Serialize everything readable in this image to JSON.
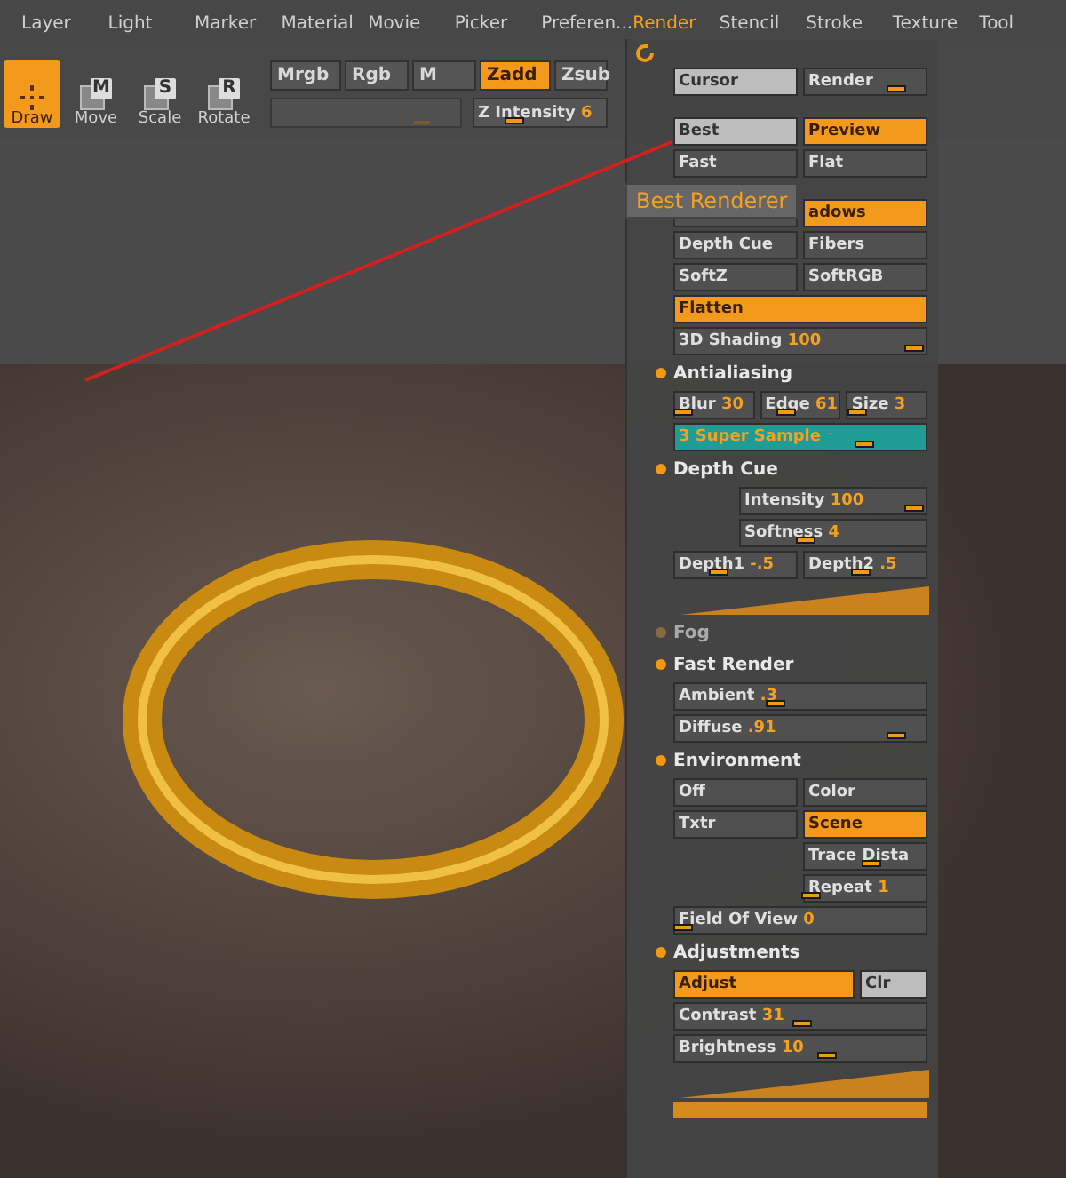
{
  "menu": [
    {
      "label": "Layer",
      "selected": false
    },
    {
      "label": "Light",
      "selected": false
    },
    {
      "label": "Marker",
      "selected": false
    },
    {
      "label": "Material",
      "selected": false
    },
    {
      "label": "Movie",
      "selected": false
    },
    {
      "label": "Picker",
      "selected": false
    },
    {
      "label": "Preferen...",
      "selected": false
    },
    {
      "label": "Render",
      "selected": true
    },
    {
      "label": "Stencil",
      "selected": false
    },
    {
      "label": "Stroke",
      "selected": false
    },
    {
      "label": "Texture",
      "selected": false
    },
    {
      "label": "Tool",
      "selected": false
    }
  ],
  "tools": [
    {
      "label": "Draw",
      "selected": true
    },
    {
      "label": "Move",
      "key": "M",
      "selected": false
    },
    {
      "label": "Scale",
      "key": "S",
      "selected": false
    },
    {
      "label": "Rotate",
      "key": "R",
      "selected": false
    }
  ],
  "modes": [
    {
      "label": "Mrgb",
      "on": false
    },
    {
      "label": "Rgb",
      "on": false
    },
    {
      "label": "M",
      "on": false
    },
    {
      "label": "Zadd",
      "on": true
    },
    {
      "label": "Zsub",
      "on": false
    }
  ],
  "rgb_intensity": {
    "level": 0.8
  },
  "z_intensity": {
    "label": "Z Intensity",
    "value": "6",
    "level": 0.3
  },
  "tooltip": "Best Renderer",
  "panel": [
    {
      "kind": "row",
      "buttons": [
        {
          "kind": "switch",
          "label": "Cursor",
          "on": true
        },
        {
          "kind": "slider",
          "label": "Render",
          "level": 0.75
        }
      ]
    },
    {
      "kind": "row",
      "buttons": [
        {
          "kind": "switch",
          "label": "Best",
          "on": true
        },
        {
          "kind": "toggle",
          "label": "Preview",
          "on": true
        }
      ]
    },
    {
      "kind": "row",
      "buttons": [
        {
          "kind": "toggle",
          "label": "Fast",
          "on": false
        },
        {
          "kind": "toggle",
          "label": "Flat",
          "on": false
        }
      ]
    },
    {
      "kind": "row",
      "buttons": [
        {
          "kind": "toggle",
          "on": false
        },
        {
          "kind": "toggle",
          "label": "adows",
          "on": true
        }
      ]
    },
    {
      "kind": "row",
      "buttons": [
        {
          "kind": "toggle",
          "label": "Depth Cue",
          "on": false
        },
        {
          "kind": "toggle",
          "label": "Fibers",
          "on": false
        }
      ]
    },
    {
      "kind": "row",
      "buttons": [
        {
          "kind": "toggle",
          "label": "SoftZ",
          "on": false
        },
        {
          "kind": "toggle",
          "label": "SoftRGB",
          "on": false
        }
      ]
    },
    {
      "kind": "row",
      "buttons": [
        {
          "kind": "toggle",
          "label": "Flatten",
          "on": true
        }
      ]
    },
    {
      "kind": "row",
      "buttons": [
        {
          "kind": "slider",
          "label": "3D Shading",
          "value": "100",
          "level": 0.95
        }
      ]
    },
    {
      "kind": "section",
      "label": "Antialiasing",
      "on": true
    },
    {
      "kind": "row",
      "buttons": [
        {
          "kind": "slider",
          "label": "Blur",
          "value": "30",
          "level": 0.1
        },
        {
          "kind": "slider",
          "label": "Edge",
          "value": "61",
          "level": 0.3
        },
        {
          "kind": "slider",
          "label": "Size",
          "value": "3",
          "level": 0.1
        }
      ]
    },
    {
      "kind": "row",
      "buttons": [
        {
          "kind": "counter",
          "label": "Super Sample",
          "value": "3",
          "on": true,
          "level": 0.75
        }
      ]
    },
    {
      "kind": "section",
      "label": "Depth Cue",
      "on": true
    },
    {
      "kind": "indented",
      "buttons": [
        {
          "kind": "slider",
          "label": "Intensity",
          "value": "100",
          "level": 0.93
        }
      ]
    },
    {
      "kind": "indented",
      "buttons": [
        {
          "kind": "slider",
          "label": "Softness",
          "value": "4",
          "level": 0.35
        }
      ]
    },
    {
      "kind": "row",
      "buttons": [
        {
          "kind": "slider",
          "label": "Depth1",
          "value": "-.5",
          "level": 0.35
        },
        {
          "kind": "slider",
          "label": "Depth2",
          "value": ".5",
          "level": 0.45
        }
      ]
    },
    {
      "kind": "ramp"
    },
    {
      "kind": "section",
      "label": "Fog",
      "on": false
    },
    {
      "kind": "section",
      "label": "Fast Render",
      "on": true
    },
    {
      "kind": "row",
      "buttons": [
        {
          "kind": "slider",
          "label": "Ambient",
          "value": ".3",
          "level": 0.4
        }
      ]
    },
    {
      "kind": "row",
      "buttons": [
        {
          "kind": "slider",
          "label": "Diffuse",
          "value": ".91",
          "level": 0.88
        }
      ]
    },
    {
      "kind": "section",
      "label": "Environment",
      "on": true
    },
    {
      "kind": "row",
      "buttons": [
        {
          "kind": "toggle",
          "label": "Off",
          "on": false
        },
        {
          "kind": "toggle",
          "label": "Color",
          "on": false
        }
      ]
    },
    {
      "kind": "row",
      "buttons": [
        {
          "kind": "toggle",
          "label": "Txtr",
          "on": false
        },
        {
          "kind": "toggle",
          "label": "Scene",
          "on": true
        }
      ]
    },
    {
      "kind": "right",
      "buttons": [
        {
          "kind": "slider",
          "label": "Trace Dista",
          "level": 0.55
        }
      ]
    },
    {
      "kind": "right",
      "buttons": [
        {
          "kind": "slider",
          "label": "Repeat",
          "value": "1",
          "level": 0.05
        }
      ]
    },
    {
      "kind": "row",
      "buttons": [
        {
          "kind": "slider",
          "label": "Field Of View",
          "value": "0",
          "level": 0.03
        }
      ]
    },
    {
      "kind": "section",
      "label": "Adjustments",
      "on": true
    },
    {
      "kind": "split",
      "buttons": [
        {
          "kind": "toggle",
          "label": "Adjust",
          "on": true
        },
        {
          "kind": "switch",
          "label": "Clr",
          "on": true
        }
      ]
    },
    {
      "kind": "row",
      "buttons": [
        {
          "kind": "slider",
          "label": "Contrast",
          "value": "31",
          "level": 0.5
        }
      ]
    },
    {
      "kind": "row",
      "buttons": [
        {
          "kind": "slider",
          "label": "Brightness",
          "value": "10",
          "level": 0.6
        }
      ]
    },
    {
      "kind": "ramp"
    },
    {
      "kind": "bar"
    }
  ]
}
